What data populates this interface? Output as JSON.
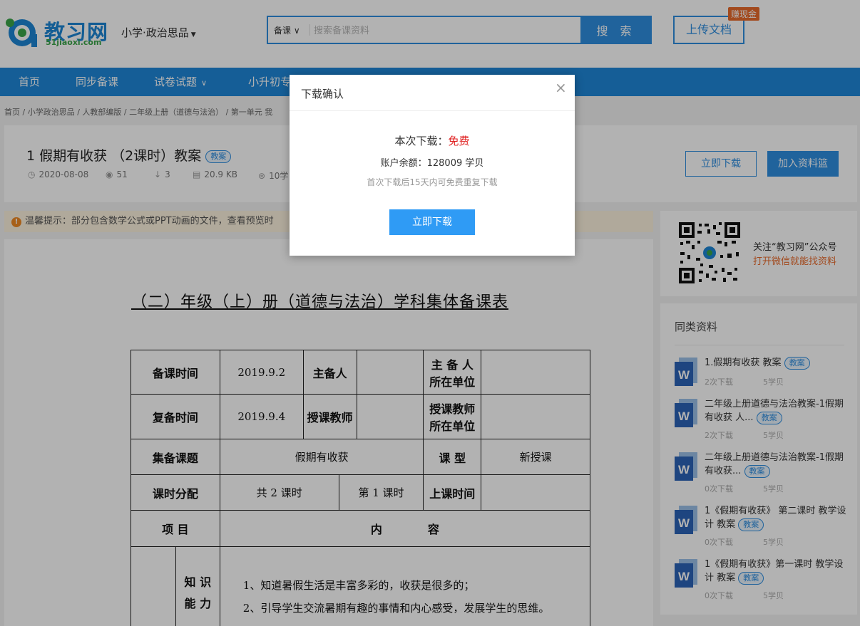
{
  "header": {
    "logo_title": "教习网",
    "logo_sub": "51jiaoxi.com",
    "subject_label": "小学·政治思品",
    "search_type": "备课",
    "search_placeholder": "搜索备课资料",
    "search_button": "搜 索",
    "upload_button": "上传文档",
    "earn_badge": "赚现金"
  },
  "nav": {
    "items": [
      "首页",
      "同步备课",
      "试卷试题",
      "小升初专"
    ]
  },
  "breadcrumb": "首页 / 小学政治思品 / 人教部编版 / 二年级上册（道德与法治） / 第一单元 我",
  "doc": {
    "title": "1 假期有收获 （2课时）教案",
    "tag": "教案",
    "date": "2020-08-08",
    "views": "51",
    "downloads": "3",
    "size": "20.9 KB",
    "pages_partial": "10学",
    "download_button": "立即下载",
    "basket_button": "加入资料篮"
  },
  "notice": {
    "icon": "!",
    "text": "温馨提示：部分包含数学公式或PPT动画的文件，查看预览时"
  },
  "preview": {
    "heading": "（二）年级（上）册（道德与法治）学科集体备课表",
    "rows": {
      "prep_time_label": "备课时间",
      "prep_time": "2019.9.2",
      "main_preparer_label": "主备人",
      "main_unit_label_1": "主 备 人",
      "main_unit_label_2": "所在单位",
      "review_time_label": "复备时间",
      "review_time": "2019.9.4",
      "teacher_label": "授课教师",
      "teacher_unit_label_1": "授课教师",
      "teacher_unit_label_2": "所在单位",
      "topic_label": "集备课题",
      "topic": "假期有收获",
      "type_label": "课 型",
      "type": "新授课",
      "hours_label": "课时分配",
      "hours_total": "共 2 课时",
      "hours_this": "第 1 课时",
      "class_time_label": "上课时间",
      "item_label": "项 目",
      "content_label": "内　　　　容",
      "knowledge_label_1": "知 识",
      "knowledge_label_2": "能 力",
      "content_1": "1、知道暑假生活是丰富多彩的，收获是很多的；",
      "content_2": "2、引导学生交流暑期有趣的事情和内心感受，发展学生的思维。"
    }
  },
  "sidebar": {
    "qr_text_1": "关注“教习网”公众号",
    "qr_text_2": "打开微信就能找资料",
    "similar_title": "同类资料",
    "items": [
      {
        "title": "1.假期有收获 教案",
        "tag": "教案",
        "downloads": "2次下载",
        "cost": "5学贝"
      },
      {
        "title": "二年级上册道德与法治教案-1假期有收获 人...",
        "tag": "教案",
        "downloads": "2次下载",
        "cost": "5学贝"
      },
      {
        "title": "二年级上册道德与法治教案-1假期有收获...",
        "tag": "教案",
        "downloads": "0次下载",
        "cost": "5学贝"
      },
      {
        "title": "1《假期有收获》 第二课时 教学设计 教案",
        "tag": "教案",
        "downloads": "0次下载",
        "cost": "5学贝"
      },
      {
        "title": "1《假期有收获》第一课时 教学设计 教案",
        "tag": "教案",
        "downloads": "0次下载",
        "cost": "5学贝"
      }
    ]
  },
  "modal": {
    "title": "下载确认",
    "close": "×",
    "download_prefix": "本次下载：",
    "download_price": "免费",
    "balance": "账户余额：128009 学贝",
    "hint": "首次下载后15天内可免费重复下载",
    "button": "立即下载"
  },
  "colors": {
    "primary": "#2f8ee0",
    "nav": "#1f87d8",
    "accent_orange": "#e86a2c",
    "free_red": "#e02020"
  }
}
